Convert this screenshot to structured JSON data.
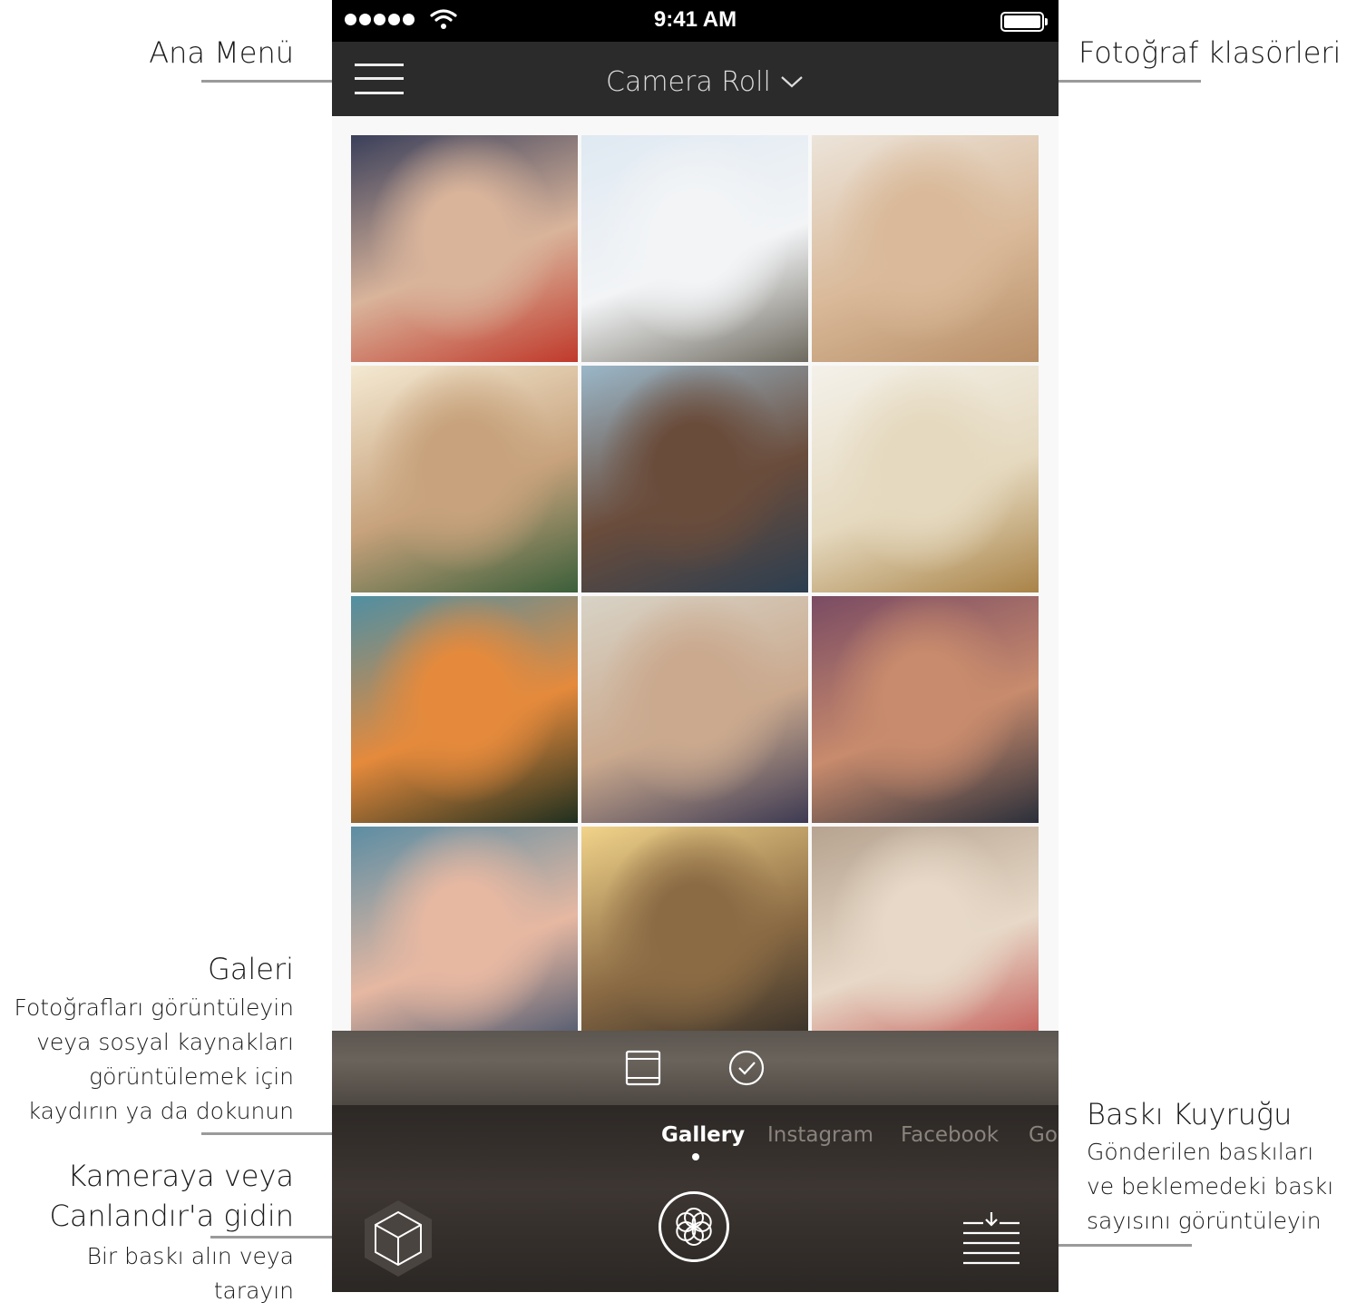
{
  "annotations": {
    "main_menu": "Ana Menü",
    "photo_folders": "Fotoğraf klasörleri",
    "gallery_title": "Galeri",
    "gallery_desc": [
      "Fotoğrafları görüntüleyin",
      "veya sosyal kaynakları",
      "görüntülemek için",
      "kaydırın ya da dokunun"
    ],
    "camera_title": [
      "Kameraya veya",
      "Canlandır'a gidin"
    ],
    "camera_desc": [
      "Bir baskı alın veya",
      "tarayın"
    ],
    "queue_title": "Baskı Kuyruğu",
    "queue_desc": [
      "Gönderilen baskıları",
      "ve beklemedeki baskı",
      "sayısını görüntüleyin"
    ]
  },
  "status_bar": {
    "time": "9:41 AM"
  },
  "navbar": {
    "folder": "Camera Roll"
  },
  "photos": [
    {
      "subject": "friends-selfie-circle",
      "colors": [
        "#3a3f5a",
        "#d9b49b",
        "#c0392b"
      ]
    },
    {
      "subject": "skateboarder-jump-palms",
      "colors": [
        "#dfe9f2",
        "#f2f4f6",
        "#6e6a5f"
      ]
    },
    {
      "subject": "kitten",
      "colors": [
        "#ece4da",
        "#d9b999",
        "#b88f68"
      ]
    },
    {
      "subject": "festival-friends-cheering",
      "colors": [
        "#f4e9d2",
        "#c7a27c",
        "#3b5f3a"
      ]
    },
    {
      "subject": "friends-in-car",
      "colors": [
        "#9ab7c9",
        "#6a4c3b",
        "#2c3e50"
      ]
    },
    {
      "subject": "couple-wheat-field",
      "colors": [
        "#f4f1ea",
        "#e5d9bf",
        "#a98348"
      ]
    },
    {
      "subject": "palm-trees-sunset",
      "colors": [
        "#4f8fa3",
        "#e58a3c",
        "#1f2f1f"
      ]
    },
    {
      "subject": "girl-blowing-kiss",
      "colors": [
        "#d8d3c6",
        "#caa98e",
        "#3d3a52"
      ]
    },
    {
      "subject": "concert-crowd-hands",
      "colors": [
        "#7a4b63",
        "#c88b6d",
        "#2b2f3a"
      ]
    },
    {
      "subject": "girls-piggyback",
      "colors": [
        "#5c8da3",
        "#e6b8a2",
        "#3f4f6a"
      ]
    },
    {
      "subject": "couple-pier-sunset",
      "colors": [
        "#f1d38a",
        "#8b6b44",
        "#2e2a26"
      ]
    },
    {
      "subject": "girls-shopping-street",
      "colors": [
        "#b6a390",
        "#e7d8c7",
        "#c0504d"
      ]
    }
  ],
  "tabs": [
    "Gallery",
    "Instagram",
    "Facebook",
    "Goo"
  ],
  "active_tab": "Gallery",
  "icons": {
    "menu": "hamburger-icon",
    "folder_chevron": "chevron-down-icon",
    "single_view": "single-photo-icon",
    "select": "checkmark-circle-icon",
    "camera": "cube-icon",
    "shutter": "flower-icon",
    "print_queue": "print-queue-icon"
  }
}
